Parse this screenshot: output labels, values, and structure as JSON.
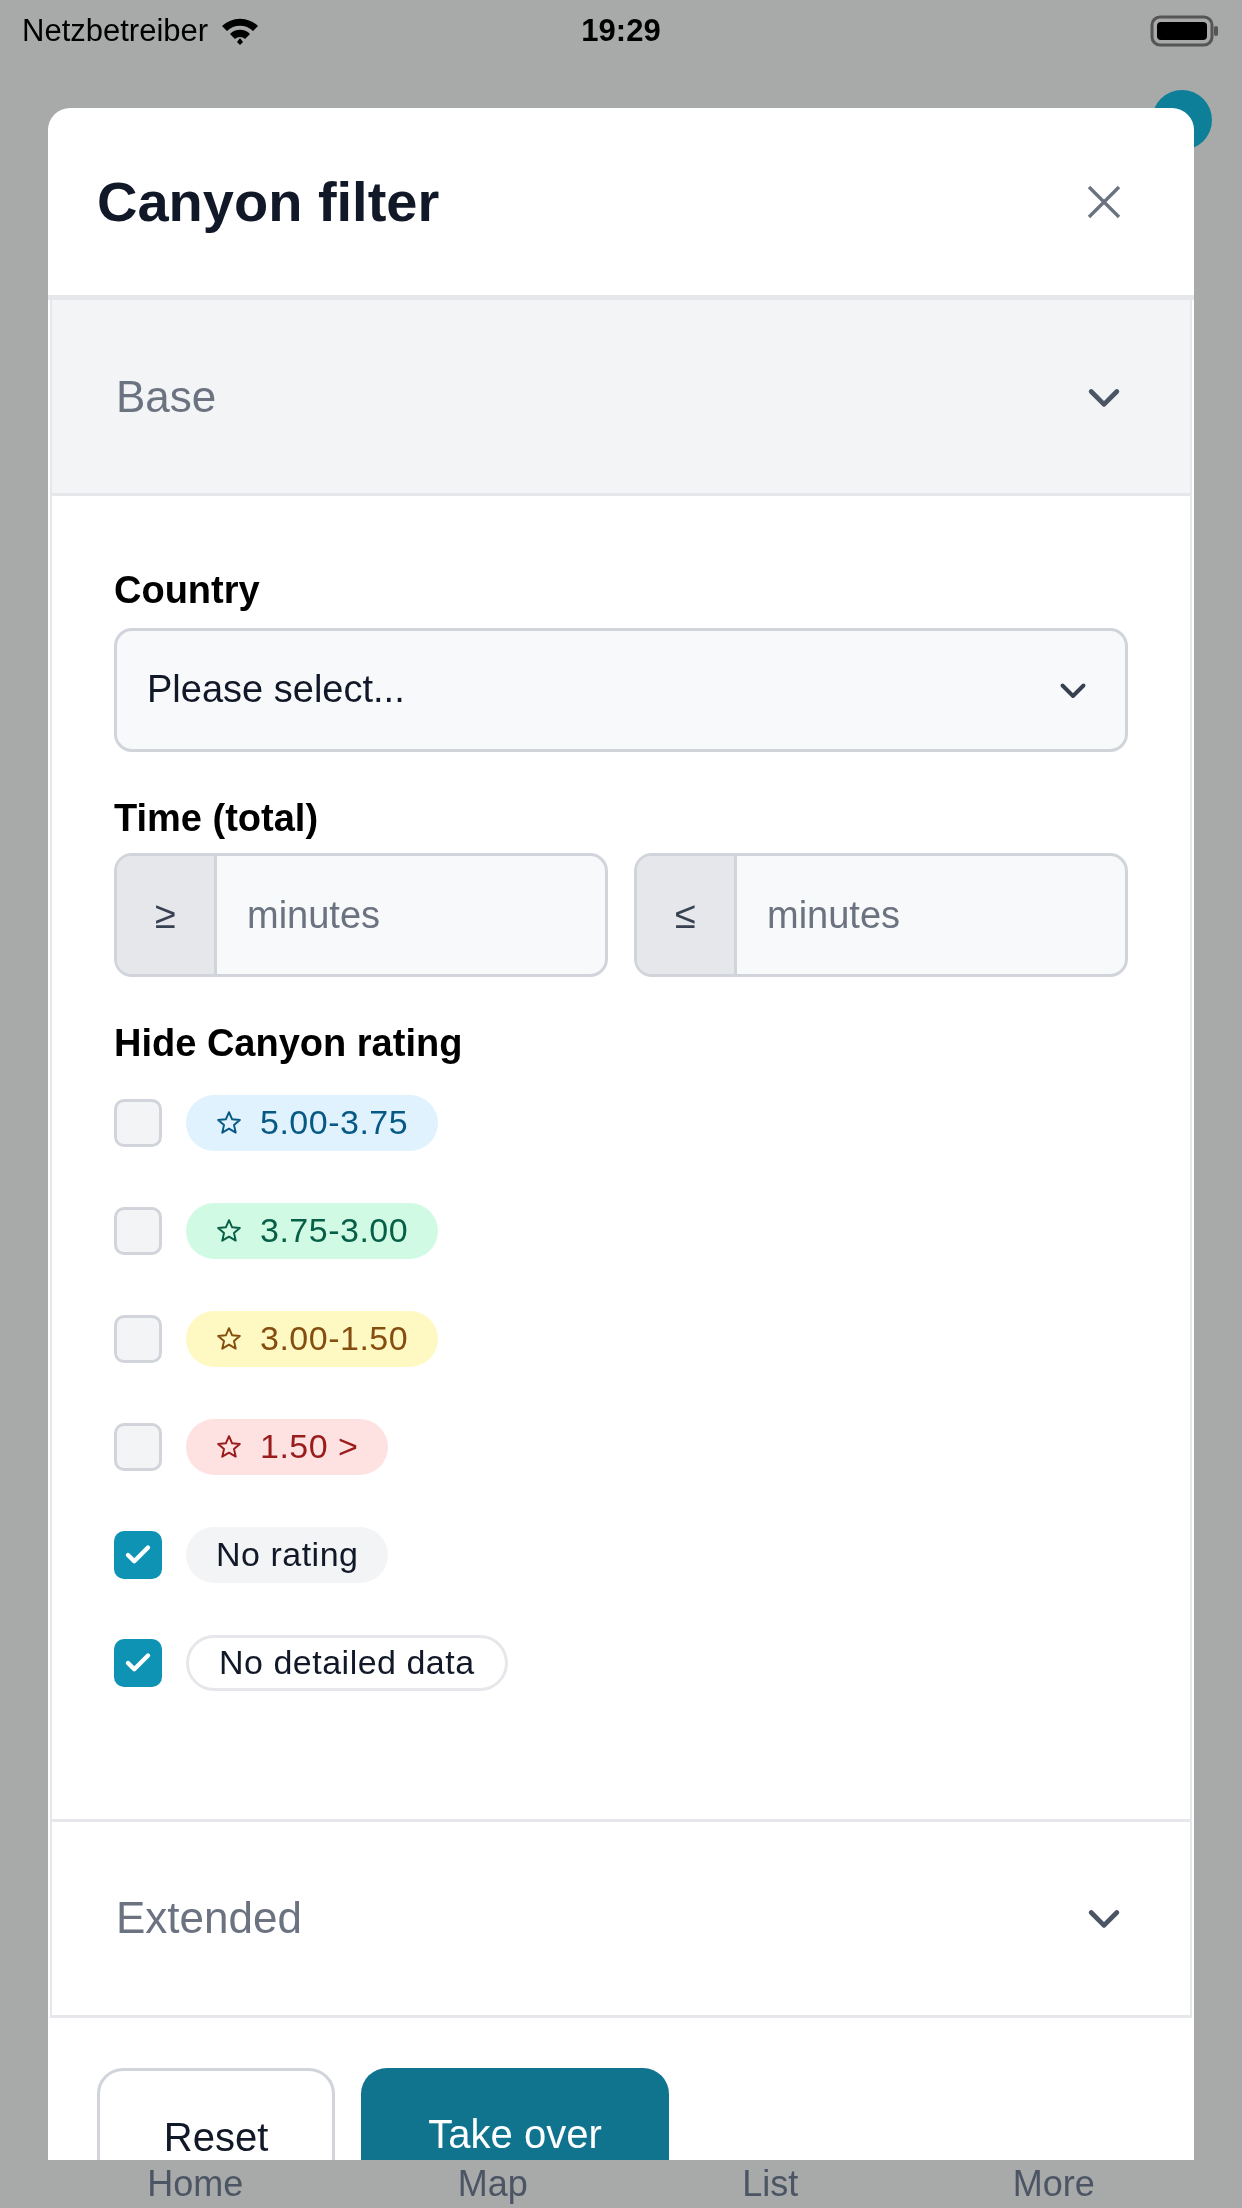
{
  "status_bar": {
    "carrier": "Netzbetreiber",
    "time": "19:29"
  },
  "background_tabs": [
    "Home",
    "Map",
    "List",
    "More"
  ],
  "dialog": {
    "title": "Canyon filter",
    "sections": [
      {
        "title": "Base",
        "expanded": true
      },
      {
        "title": "Extended",
        "expanded": false
      }
    ],
    "country": {
      "label": "Country",
      "placeholder": "Please select..."
    },
    "time": {
      "label": "Time (total)",
      "fields": [
        {
          "prefix": "≥",
          "placeholder": "minutes"
        },
        {
          "prefix": "≤",
          "placeholder": "minutes"
        }
      ]
    },
    "rating": {
      "label": "Hide Canyon rating",
      "options": [
        {
          "label": "5.00-3.75",
          "kind": "blue",
          "checked": false
        },
        {
          "label": "3.75-3.00",
          "kind": "green",
          "checked": false
        },
        {
          "label": "3.00-1.50",
          "kind": "yellow",
          "checked": false
        },
        {
          "label": "1.50 >",
          "kind": "red",
          "checked": false
        },
        {
          "label": "No rating",
          "kind": "gray",
          "checked": true
        },
        {
          "label": "No detailed data",
          "kind": "outline",
          "checked": true
        }
      ]
    },
    "buttons": [
      {
        "label": "Reset",
        "kind": "secondary"
      },
      {
        "label": "Take over",
        "kind": "primary"
      }
    ]
  }
}
